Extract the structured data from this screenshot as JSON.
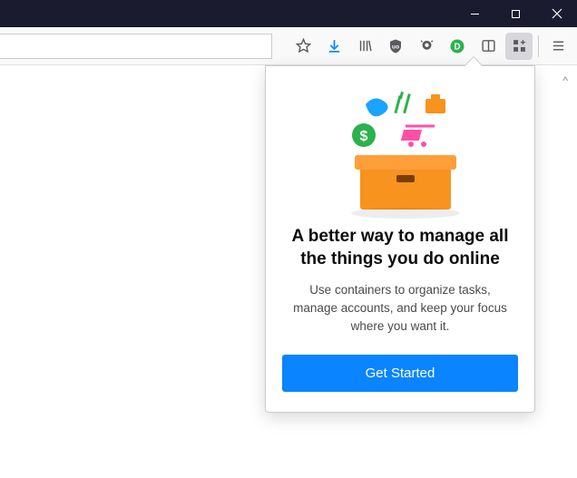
{
  "window": {
    "minimize": "minimize",
    "maximize": "maximize",
    "close": "close"
  },
  "toolbar": {
    "url_value": "",
    "icons": {
      "bookmark": "bookmark-star",
      "downloads": "downloads",
      "library": "library",
      "ublock": "shield",
      "unknown": "bell-extension",
      "disconnect": "disconnect-d",
      "reader": "reader-view",
      "containers": "multi-account-containers",
      "menu": "hamburger-menu"
    },
    "downloads_color": "#0a84ff",
    "disconnect_color": "#2bb24c"
  },
  "popup": {
    "heading": "A better way to manage all the things you do online",
    "body": "Use containers to organize tasks, manage accounts, and keep your focus where you want it.",
    "cta_label": "Get Started",
    "illustration": {
      "box_color": "#f7931e",
      "box_dark": "#d96f00",
      "items": [
        "blue-blob",
        "green-fork",
        "orange-bag",
        "green-dollar",
        "pink-cart"
      ]
    }
  },
  "colors": {
    "titlebar": "#1a1b2e",
    "accent": "#0a84ff"
  }
}
